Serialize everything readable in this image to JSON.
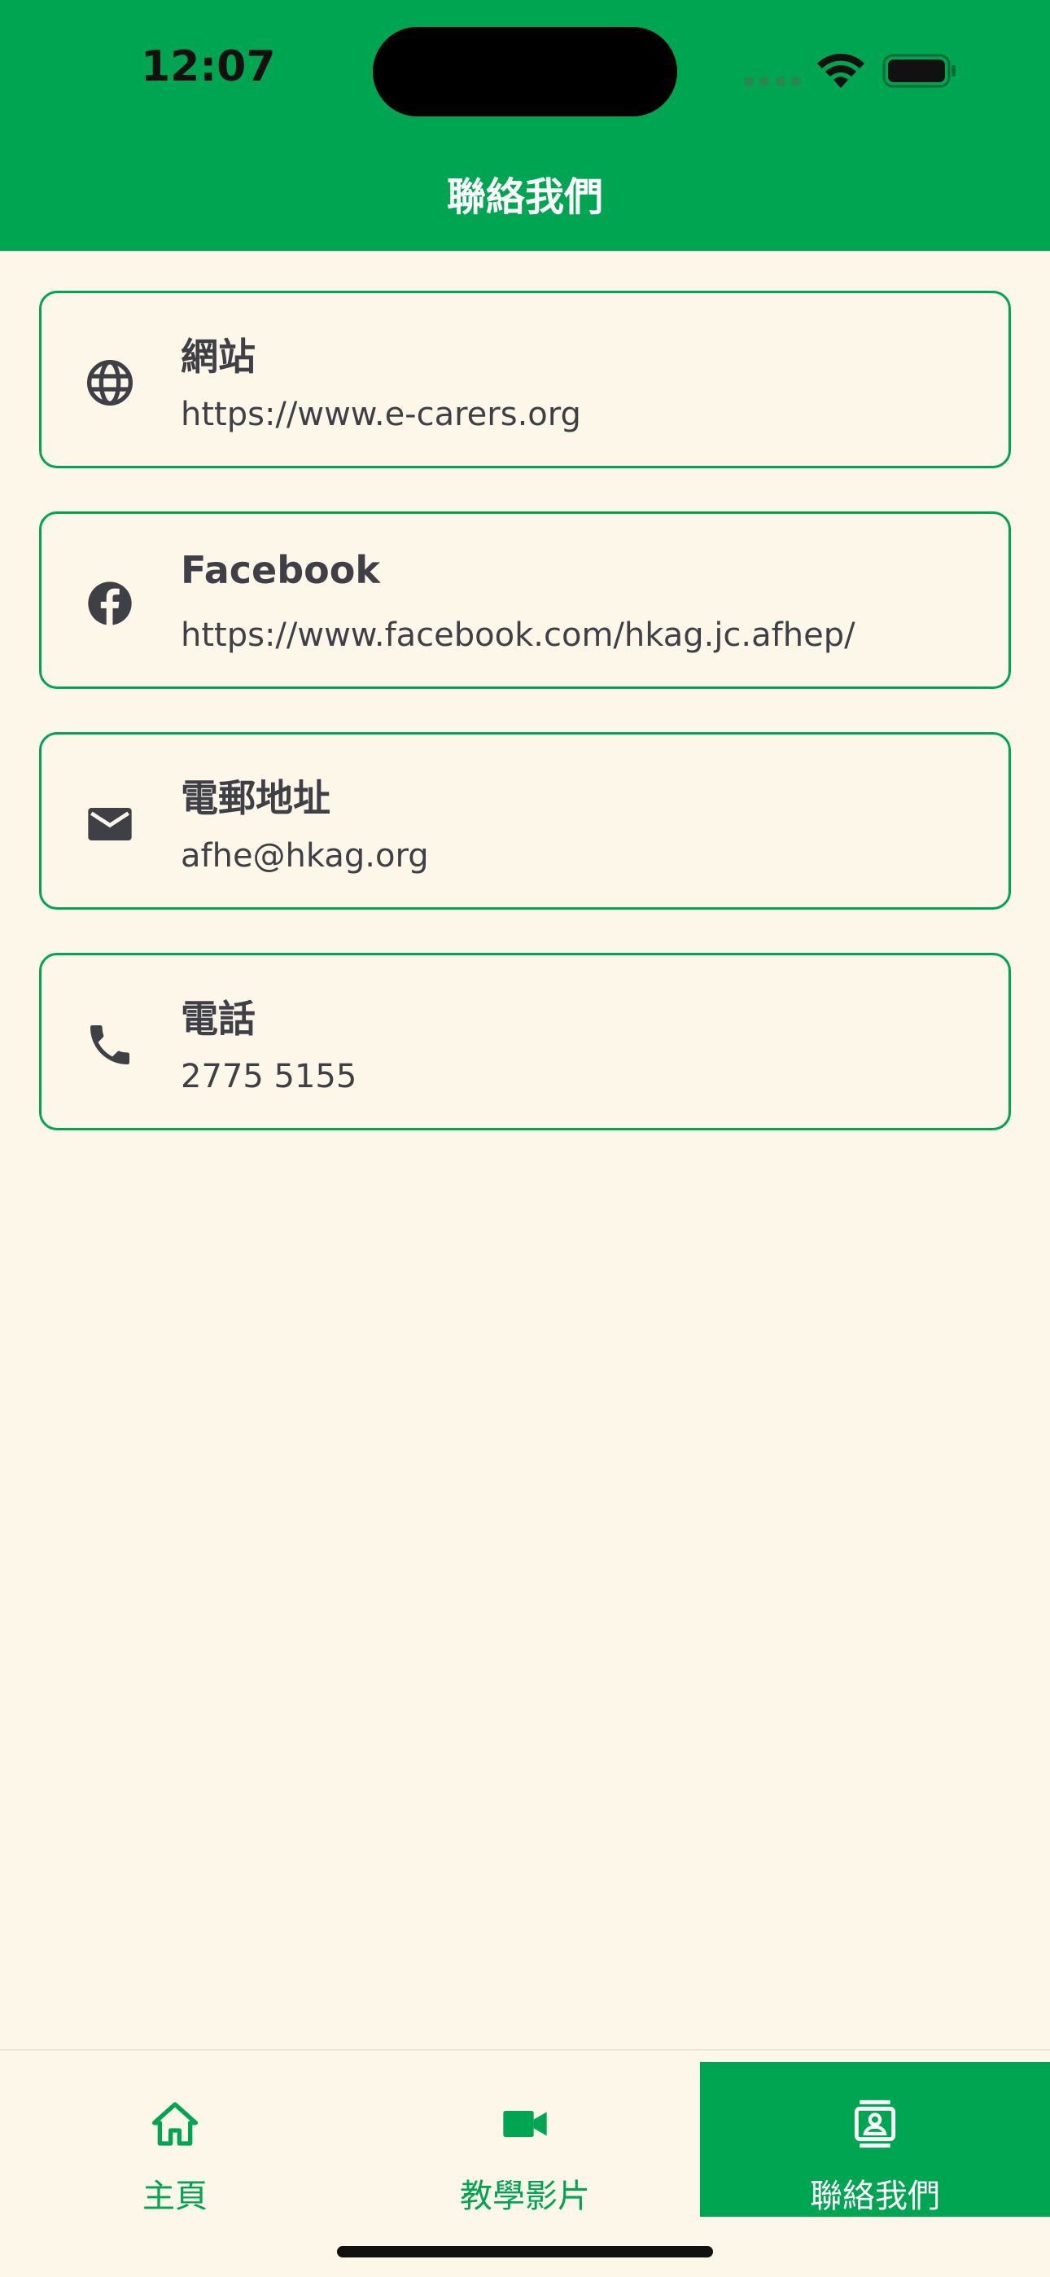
{
  "status_bar": {
    "time": "12:07",
    "icons": [
      "cellular-signal-icon",
      "wifi-icon",
      "battery-icon"
    ]
  },
  "header": {
    "title": "聯絡我們"
  },
  "contacts": [
    {
      "icon": "globe-icon",
      "title": "網站",
      "value": "https://www.e-carers.org"
    },
    {
      "icon": "facebook-icon",
      "title": "Facebook",
      "value": "https://www.facebook.com/hkag.jc.afhep/"
    },
    {
      "icon": "mail-icon",
      "title": "電郵地址",
      "value": "afhe@hkag.org"
    },
    {
      "icon": "phone-icon",
      "title": "電話",
      "value": "2775 5155"
    }
  ],
  "bottom_nav": {
    "items": [
      {
        "icon": "home-icon",
        "label": "主頁",
        "active": false
      },
      {
        "icon": "video-camera-icon",
        "label": "教學影片",
        "active": false
      },
      {
        "icon": "contact-card-icon",
        "label": "聯絡我們",
        "active": true
      }
    ]
  },
  "colors": {
    "brand_green": "#00A551",
    "background": "#FDF7EA",
    "text": "#3f3f46"
  }
}
